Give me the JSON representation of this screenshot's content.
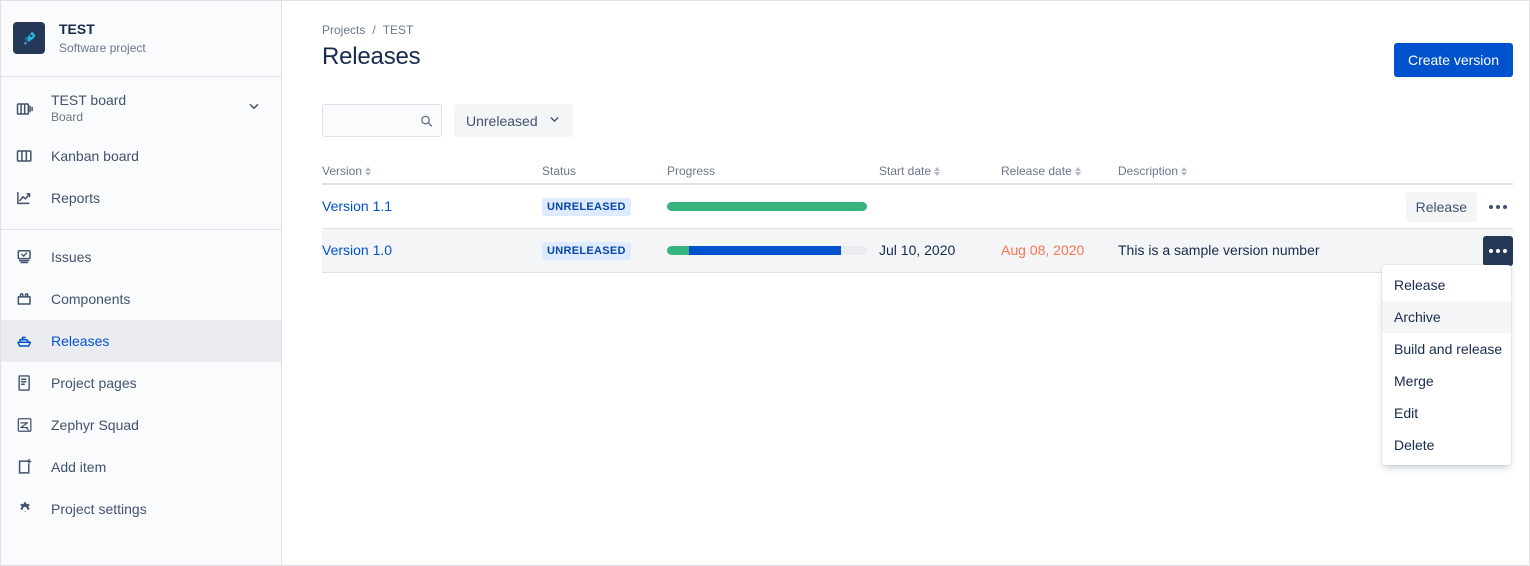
{
  "sidebar": {
    "project": {
      "name": "TEST",
      "type": "Software project",
      "avatar_icon": "rocket-icon",
      "avatar_bg": "#253858"
    },
    "board": {
      "name": "TEST board",
      "subtitle": "Board",
      "icon": "board-stack-icon",
      "chevron_icon": "chevron-down-icon"
    },
    "items": [
      {
        "label": "Kanban board",
        "icon": "columns-icon",
        "active": false
      },
      {
        "label": "Reports",
        "icon": "chart-line-icon",
        "active": false
      },
      {
        "label": "Issues",
        "icon": "issues-icon",
        "active": false
      },
      {
        "label": "Components",
        "icon": "components-icon",
        "active": false
      },
      {
        "label": "Releases",
        "icon": "ship-icon",
        "active": true
      },
      {
        "label": "Project pages",
        "icon": "page-icon",
        "active": false
      },
      {
        "label": "Zephyr Squad",
        "icon": "zephyr-icon",
        "active": false
      },
      {
        "label": "Add item",
        "icon": "add-item-icon",
        "active": false
      },
      {
        "label": "Project settings",
        "icon": "gear-icon",
        "active": false
      }
    ]
  },
  "breadcrumb": {
    "projects": "Projects",
    "separator": "/",
    "current": "TEST"
  },
  "header": {
    "title": "Releases",
    "create_button": "Create version"
  },
  "filters": {
    "search_value": "",
    "search_placeholder": "",
    "search_icon": "search-icon",
    "status_filter": "Unreleased",
    "status_chevron": "chevron-down-icon"
  },
  "table": {
    "columns": [
      {
        "label": "Version",
        "sortable": true
      },
      {
        "label": "Status",
        "sortable": false
      },
      {
        "label": "Progress",
        "sortable": false
      },
      {
        "label": "Start date",
        "sortable": true
      },
      {
        "label": "Release date",
        "sortable": true
      },
      {
        "label": "Description",
        "sortable": true
      }
    ],
    "rows": [
      {
        "version": "Version 1.1",
        "status": "UNRELEASED",
        "progress": {
          "done": 100,
          "in_progress": 0,
          "todo": 0
        },
        "start_date": "",
        "release_date": "",
        "release_date_overdue": false,
        "description": "",
        "release_button": "Release",
        "more_icon": "more-horizontal-icon",
        "more_pressed": false,
        "hovered": false
      },
      {
        "version": "Version 1.0",
        "status": "UNRELEASED",
        "progress": {
          "done": 11,
          "in_progress": 76,
          "todo": 13
        },
        "start_date": "Jul 10, 2020",
        "release_date": "Aug 08, 2020",
        "release_date_overdue": true,
        "description": "This is a sample version number",
        "release_button": "",
        "more_icon": "more-horizontal-icon",
        "more_pressed": true,
        "hovered": true
      }
    ]
  },
  "context_menu": {
    "visible": true,
    "items": [
      {
        "label": "Release",
        "hovered": false
      },
      {
        "label": "Archive",
        "hovered": true
      },
      {
        "label": "Build and release",
        "hovered": false
      },
      {
        "label": "Merge",
        "hovered": false
      },
      {
        "label": "Edit",
        "hovered": false
      },
      {
        "label": "Delete",
        "hovered": false
      }
    ]
  },
  "colors": {
    "accent": "#0052CC",
    "progress_done": "#36B37E",
    "progress_in_progress": "#0052CC",
    "progress_todo": "#EBECF0",
    "badge_bg": "#DEEBFF",
    "badge_text": "#0747A6",
    "overdue_text": "#FF7452"
  }
}
